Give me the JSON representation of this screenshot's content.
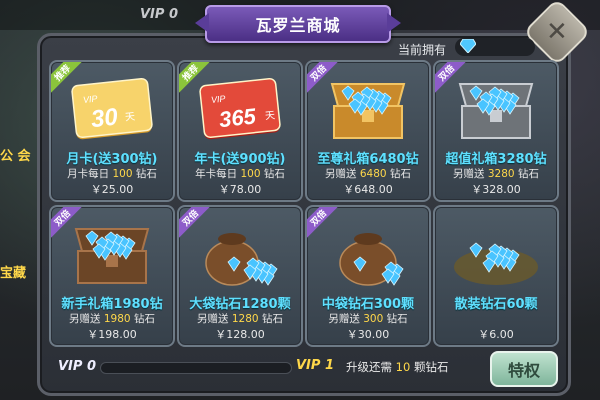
{
  "top": {
    "vip_label": "VIP 0"
  },
  "side": {
    "left1": "公 会",
    "left2": "宝藏"
  },
  "shop": {
    "title": "瓦罗兰商城",
    "owned_label": "当前拥有",
    "cards": [
      {
        "ribbon": "推荐",
        "ribbon_type": "recommend",
        "art": "vip-card-30",
        "art_text": "30",
        "art_unit": "天",
        "name": "月卡(送300钻)",
        "sub_prefix": "月卡每日",
        "sub_num": "100",
        "sub_suffix": "钻石",
        "price": "￥25.00"
      },
      {
        "ribbon": "推荐",
        "ribbon_type": "recommend",
        "art": "vip-card-365",
        "art_text": "365",
        "art_unit": "天",
        "name": "年卡(送900钻)",
        "sub_prefix": "年卡每日",
        "sub_num": "100",
        "sub_suffix": "钻石",
        "price": "￥78.00"
      },
      {
        "ribbon": "双倍",
        "ribbon_type": "double",
        "art": "gold-chest-icon",
        "name": "至尊礼箱6480钻",
        "sub_prefix": "另赠送",
        "sub_num": "6480",
        "sub_suffix": "钻石",
        "price": "￥648.00"
      },
      {
        "ribbon": "双倍",
        "ribbon_type": "double",
        "art": "silver-chest-icon",
        "name": "超值礼箱3280钻",
        "sub_prefix": "另赠送",
        "sub_num": "3280",
        "sub_suffix": "钻石",
        "price": "￥328.00"
      },
      {
        "ribbon": "双倍",
        "ribbon_type": "double",
        "art": "wood-chest-icon",
        "name": "新手礼箱1980钻",
        "sub_prefix": "另赠送",
        "sub_num": "1980",
        "sub_suffix": "钻石",
        "price": "￥198.00"
      },
      {
        "ribbon": "双倍",
        "ribbon_type": "double",
        "art": "large-bag-icon",
        "name": "大袋钻石1280颗",
        "sub_prefix": "另赠送",
        "sub_num": "1280",
        "sub_suffix": "钻石",
        "price": "￥128.00"
      },
      {
        "ribbon": "双倍",
        "ribbon_type": "double",
        "art": "medium-bag-icon",
        "name": "中袋钻石300颗",
        "sub_prefix": "另赠送",
        "sub_num": "300",
        "sub_suffix": "钻石",
        "price": "￥30.00"
      },
      {
        "ribbon": "",
        "ribbon_type": "none",
        "art": "gem-pile-icon",
        "name": "散装钻石60颗",
        "sub_prefix": "",
        "sub_num": "",
        "sub_suffix": "",
        "price": "￥6.00"
      }
    ]
  },
  "bottom": {
    "vip_now": "VIP 0",
    "vip_next": "VIP 1",
    "progress": 0,
    "upgrade_prefix": "升级还需",
    "upgrade_num": "10",
    "upgrade_suffix": "颗钻石",
    "privilege_button": "特权"
  },
  "colors": {
    "accent": "#5fe0ff",
    "gold": "#ffd84a",
    "title_purple": "#6a4aa8"
  }
}
